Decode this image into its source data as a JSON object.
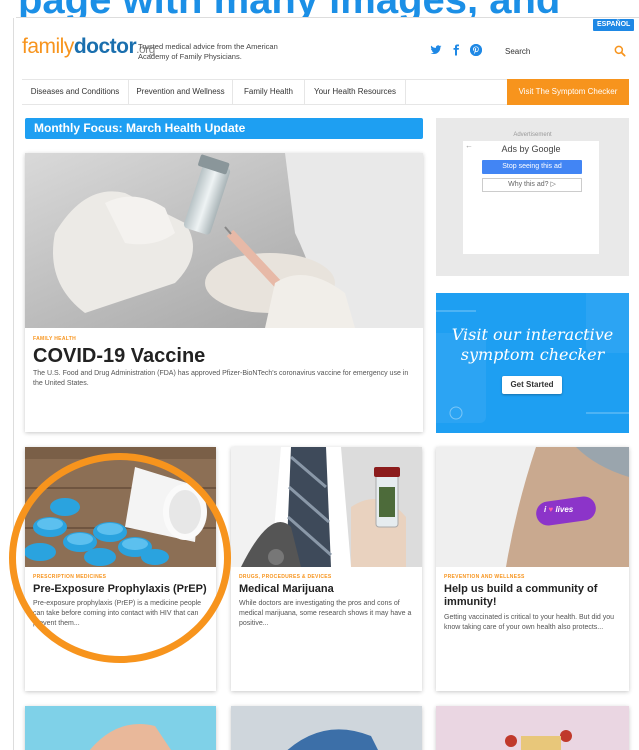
{
  "banner": {
    "text": "page with many images, and"
  },
  "header": {
    "espanol": "ESPAÑOL",
    "logo": {
      "part1": "family",
      "part2": "doctor",
      "part3": ".org"
    },
    "tagline": "Trusted medical advice from the American Academy of Family Physicians.",
    "social": {
      "twitter": "t",
      "facebook": "f",
      "pinterest": "p"
    },
    "search_placeholder": "Search"
  },
  "nav": {
    "items": [
      "Diseases and Conditions",
      "Prevention and Wellness",
      "Family Health",
      "Your Health Resources"
    ],
    "cta": "Visit The Symptom Checker"
  },
  "focus": {
    "title": "Monthly Focus: March Health Update"
  },
  "featured": {
    "category": "FAMILY HEALTH",
    "title": "COVID-19 Vaccine",
    "description": "The U.S. Food and Drug Administration (FDA) has approved Pfizer-BioNTech's coronavirus vaccine for emergency use in the United States."
  },
  "ad": {
    "label": "Advertisement",
    "ads_by": "Ads by Google",
    "stop": "Stop seeing this ad",
    "why": "Why this ad? ▷"
  },
  "symptom_checker": {
    "line1": "Visit our interactive",
    "line2": "symptom checker",
    "button": "Get Started"
  },
  "cards": [
    {
      "category": "PRESCRIPTION MEDICINES",
      "title": "Pre-Exposure Prophylaxis (PrEP)",
      "description": "Pre-exposure prophylaxis (PrEP) is a medicine people can take before coming into contact with HIV that can prevent them..."
    },
    {
      "category": "DRUGS, PROCEDURES & DEVICES",
      "title": "Medical Marijuana",
      "description": "While doctors are investigating the pros and cons of medical marijuana, some research shows it may have a positive..."
    },
    {
      "category": "PREVENTION AND WELLNESS",
      "title": "Help us build a community of immunity!",
      "description": "Getting vaccinated is critical to your health. But did you know taking care of your own health also protects..."
    }
  ],
  "bandage_text": {
    "part1": "i",
    "part2": "lives"
  },
  "colors": {
    "accent_orange": "#f7941d",
    "brand_blue": "#1e9ff2",
    "logo_blue": "#1a6fae"
  }
}
